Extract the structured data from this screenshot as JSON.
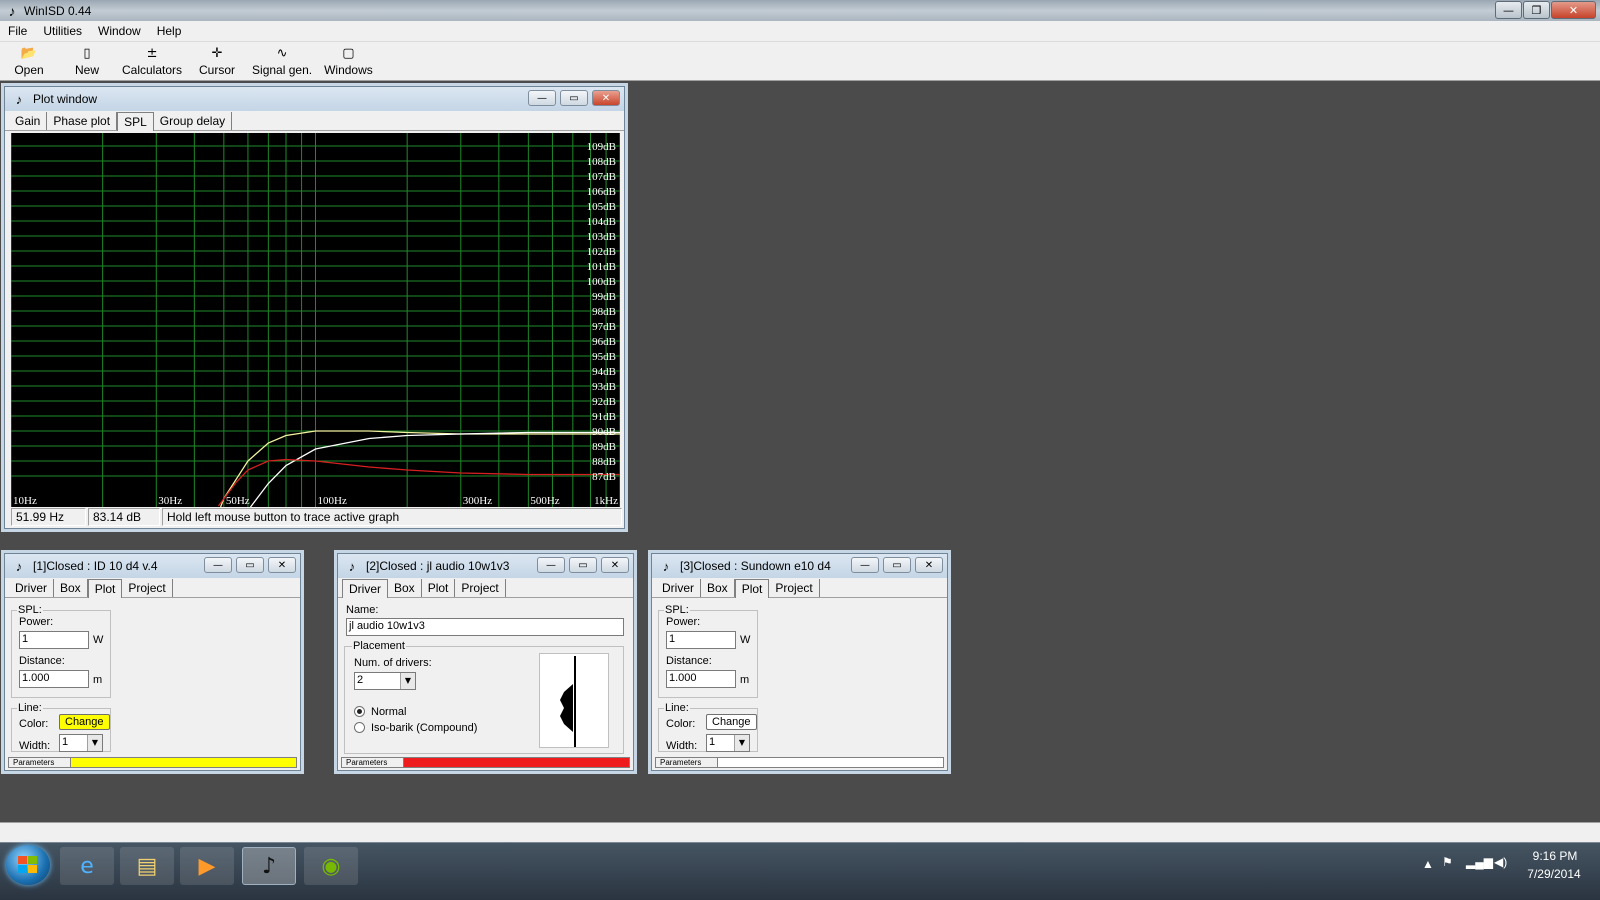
{
  "app": {
    "title": "WinISD 0.44"
  },
  "menu": [
    "File",
    "Utilities",
    "Window",
    "Help"
  ],
  "toolbar": [
    {
      "label": "Open",
      "icon": "open-folder-icon"
    },
    {
      "label": "New",
      "icon": "new-file-icon"
    },
    {
      "label": "Calculators",
      "icon": "calculator-icon"
    },
    {
      "label": "Cursor",
      "icon": "cursor-icon"
    },
    {
      "label": "Signal gen.",
      "icon": "signal-gen-icon"
    },
    {
      "label": "Windows",
      "icon": "windows-icon"
    }
  ],
  "plot_window": {
    "title": "Plot window",
    "tabs": [
      "Gain",
      "Phase plot",
      "SPL",
      "Group delay"
    ],
    "active_tab": "SPL",
    "status": {
      "freq": "51.99 Hz",
      "level": "83.14 dB",
      "hint": "Hold left mouse button to trace active graph"
    }
  },
  "chart_data": {
    "type": "line",
    "x_scale": "log",
    "x_range": [
      10,
      1000
    ],
    "y_range": [
      86,
      110
    ],
    "x_ticks": [
      "10Hz",
      "30Hz",
      "50Hz",
      "100Hz",
      "300Hz",
      "500Hz",
      "1kHz"
    ],
    "y_ticks": [
      "109dB",
      "108dB",
      "107dB",
      "106dB",
      "105dB",
      "104dB",
      "103dB",
      "102dB",
      "101dB",
      "100dB",
      "99dB",
      "98dB",
      "97dB",
      "96dB",
      "95dB",
      "94dB",
      "93dB",
      "92dB",
      "91dB",
      "90dB",
      "89dB",
      "88dB",
      "87dB"
    ],
    "grid": true,
    "series": [
      {
        "color": "#f3f3a0",
        "x": [
          44,
          50,
          60,
          70,
          80,
          100,
          150,
          200,
          300,
          500,
          1000
        ],
        "y": [
          82.5,
          85.5,
          88.0,
          89.2,
          89.7,
          90.0,
          90.0,
          89.9,
          89.8,
          89.8,
          89.8
        ]
      },
      {
        "color": "#ffffff",
        "x": [
          51,
          60,
          70,
          80,
          100,
          150,
          200,
          300,
          500,
          1000
        ],
        "y": [
          82.5,
          84.7,
          86.5,
          87.7,
          88.8,
          89.5,
          89.7,
          89.8,
          89.9,
          89.9
        ]
      },
      {
        "color": "#d62020",
        "x": [
          48,
          55,
          60,
          70,
          80,
          100,
          150,
          200,
          300,
          500,
          1000
        ],
        "y": [
          85.0,
          86.6,
          87.4,
          88.0,
          88.1,
          88.0,
          87.6,
          87.4,
          87.2,
          87.1,
          87.1
        ]
      }
    ]
  },
  "projects": [
    {
      "title": "[1]Closed : ID 10 d4 v.4",
      "tabs": [
        "Driver",
        "Box",
        "Plot",
        "Project"
      ],
      "active_tab": "Plot",
      "spl_label": "SPL:",
      "power_label": "Power:",
      "power": "1",
      "power_unit": "W",
      "distance_label": "Distance:",
      "distance": "1.000",
      "distance_unit": "m",
      "line_label": "Line:",
      "color_label": "Color:",
      "change_label": "Change",
      "width_label": "Width:",
      "width": "1",
      "params_label": "Parameters",
      "line_color": "#ffff00"
    },
    {
      "title": "[2]Closed : jl audio 10w1v3",
      "tabs": [
        "Driver",
        "Box",
        "Plot",
        "Project"
      ],
      "active_tab": "Driver",
      "name_label": "Name:",
      "name": "jl audio 10w1v3",
      "placement_label": "Placement",
      "num_drivers_label": "Num. of drivers:",
      "num_drivers": "2",
      "normal_label": "Normal",
      "isobarik_label": "Iso-barik (Compound)",
      "params_label": "Parameters",
      "line_color": "#ee1c1c"
    },
    {
      "title": "[3]Closed : Sundown e10 d4",
      "tabs": [
        "Driver",
        "Box",
        "Plot",
        "Project"
      ],
      "active_tab": "Plot",
      "spl_label": "SPL:",
      "power_label": "Power:",
      "power": "1",
      "power_unit": "W",
      "distance_label": "Distance:",
      "distance": "1.000",
      "distance_unit": "m",
      "line_label": "Line:",
      "color_label": "Color:",
      "change_label": "Change",
      "width_label": "Width:",
      "width": "1",
      "params_label": "Parameters",
      "line_color": "#ffffff"
    }
  ],
  "taskbar": {
    "time": "9:16 PM",
    "date": "7/29/2014"
  }
}
